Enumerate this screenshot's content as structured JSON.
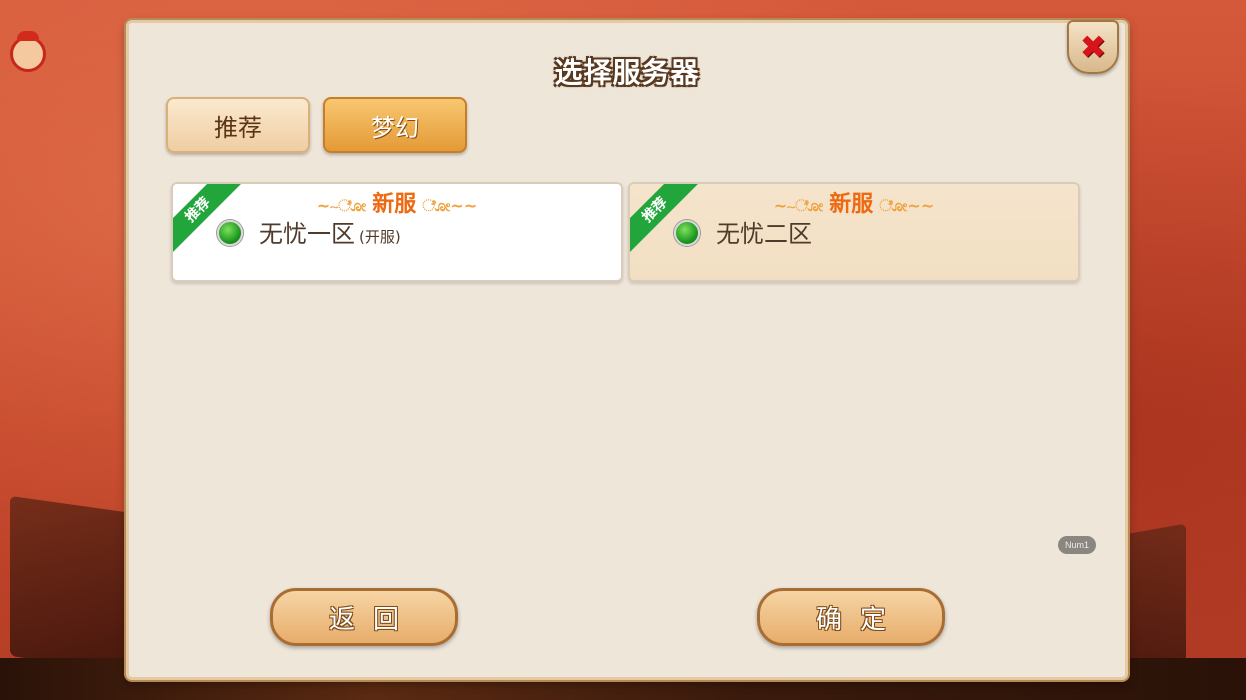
{
  "dialog": {
    "title": "选择服务器"
  },
  "tabs": [
    {
      "label": "推荐",
      "selected": false
    },
    {
      "label": "梦幻",
      "selected": true
    }
  ],
  "servers": [
    {
      "tag": "推荐",
      "badge": "新服",
      "name": "无忧一区",
      "suffix": "(开服)",
      "status_color": "#22a63c"
    },
    {
      "tag": "推荐",
      "badge": "新服",
      "name": "无忧二区",
      "suffix": "",
      "status_color": "#22a63c"
    }
  ],
  "buttons": {
    "back_label": "返回",
    "confirm_label": "确定"
  },
  "num_badge": "Num1",
  "icons": {
    "close": "close-icon",
    "avatar": "avatar-icon"
  },
  "colors": {
    "accent_orange": "#e49a36",
    "close_red": "#d7141a",
    "badge_orange": "#ee6a12",
    "ribbon_green": "#22a63c"
  }
}
